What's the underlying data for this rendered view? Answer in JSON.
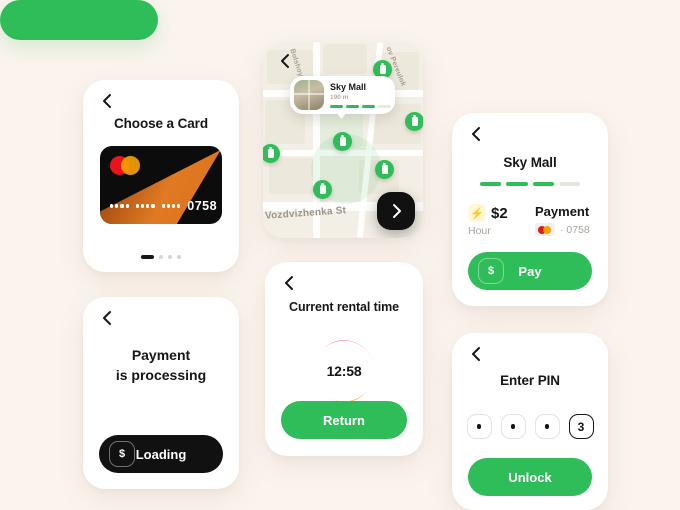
{
  "meta": {
    "background_color": "#FBF4EE",
    "accent_green": "#2EBD59",
    "dark": "#111111"
  },
  "icons": {
    "back": "chevron-left-icon",
    "forward": "chevron-right-icon",
    "bolt": "⚡",
    "dollar": "$"
  },
  "choose_card": {
    "title": "Choose a Card",
    "card": {
      "brand": "mastercard",
      "masked_groups": [
        "••••",
        "••••",
        "••••"
      ],
      "last4": "0758"
    },
    "pager": {
      "total": 4,
      "active_index": 0
    }
  },
  "map": {
    "street_labels": [
      "Bolshoy",
      "ov Pereulok",
      "Vozdvizhenka St"
    ],
    "tooltip": {
      "name": "Sky Mall",
      "distance": "190 m",
      "battery_segments": 4,
      "battery_filled": 3
    },
    "pins_count": 6,
    "fab_label": "›"
  },
  "pay": {
    "title": "Sky Mall",
    "battery_segments": 4,
    "battery_filled": 3,
    "price": "$2",
    "price_unit": "Hour",
    "payment_label": "Payment",
    "card_last4": "· 0758",
    "button_label": "Pay",
    "button_chip": "$"
  },
  "processing": {
    "line1": "Payment",
    "line2": "is processing",
    "button_label": "Loading",
    "button_chip": "$"
  },
  "rental": {
    "title": "Current rental time",
    "time": "12:58",
    "button_label": "Return"
  },
  "pin": {
    "title": "Enter PIN",
    "slots": [
      "•",
      "•",
      "•",
      "3"
    ],
    "active_index": 3,
    "button_label": "Unlock"
  }
}
